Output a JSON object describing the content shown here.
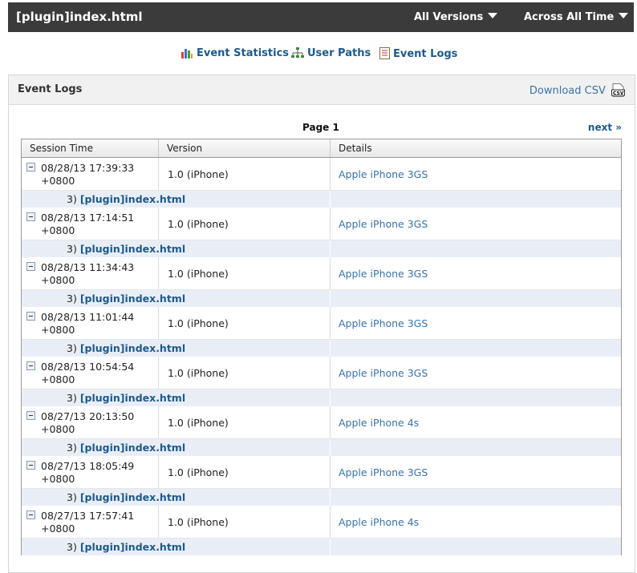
{
  "header": {
    "title": "[plugin]index.html",
    "versions": "All Versions",
    "timeframe": "Across All Time"
  },
  "nav": [
    {
      "label": "Event Statistics"
    },
    {
      "label": "User Paths"
    },
    {
      "label": "Event Logs"
    }
  ],
  "panel": {
    "title": "Event Logs",
    "download": "Download CSV",
    "page": "Page 1",
    "next": "next »",
    "columns": [
      "Session Time",
      "Version",
      "Details"
    ]
  },
  "rows": [
    {
      "date": "08/28/13 17:39:33",
      "tz": "+0800",
      "version": "1.0 (iPhone)",
      "details": "Apple iPhone 3GS",
      "step": "3)",
      "event": "[plugin]index.html"
    },
    {
      "date": "08/28/13 17:14:51",
      "tz": "+0800",
      "version": "1.0 (iPhone)",
      "details": "Apple iPhone 3GS",
      "step": "3)",
      "event": "[plugin]index.html"
    },
    {
      "date": "08/28/13 11:34:43",
      "tz": "+0800",
      "version": "1.0 (iPhone)",
      "details": "Apple iPhone 3GS",
      "step": "3)",
      "event": "[plugin]index.html"
    },
    {
      "date": "08/28/13 11:01:44",
      "tz": "+0800",
      "version": "1.0 (iPhone)",
      "details": "Apple iPhone 3GS",
      "step": "3)",
      "event": "[plugin]index.html"
    },
    {
      "date": "08/28/13 10:54:54",
      "tz": "+0800",
      "version": "1.0 (iPhone)",
      "details": "Apple iPhone 3GS",
      "step": "3)",
      "event": "[plugin]index.html"
    },
    {
      "date": "08/27/13 20:13:50",
      "tz": "+0800",
      "version": "1.0 (iPhone)",
      "details": "Apple iPhone 4s",
      "step": "3)",
      "event": "[plugin]index.html"
    },
    {
      "date": "08/27/13 18:05:49",
      "tz": "+0800",
      "version": "1.0 (iPhone)",
      "details": "Apple iPhone 3GS",
      "step": "3)",
      "event": "[plugin]index.html"
    },
    {
      "date": "08/27/13 17:57:41",
      "tz": "+0800",
      "version": "1.0 (iPhone)",
      "details": "Apple iPhone 4s",
      "step": "3)",
      "event": "[plugin]index.html"
    }
  ]
}
